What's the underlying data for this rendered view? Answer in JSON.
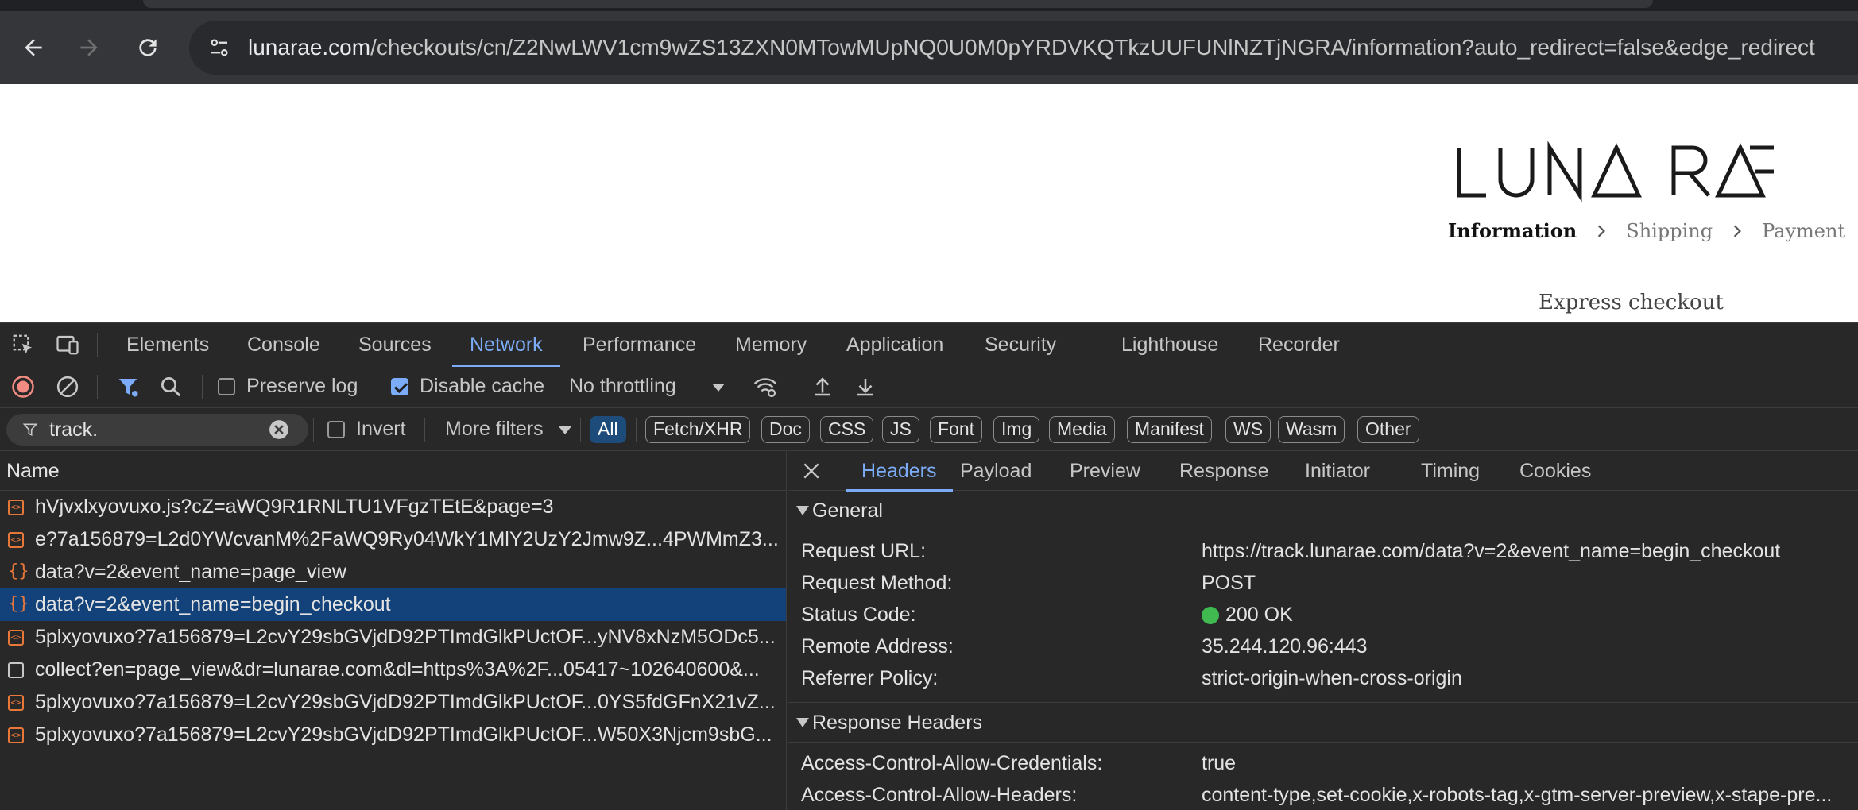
{
  "browser": {
    "url_host": "lunarae.com",
    "url_rest": "/checkouts/cn/Z2NwLWV1cm9wZS13ZXN0MTowMUpNQ0U0M0pYRDVKQTkzUUFUNlNZTjNGRA/information?auto_redirect=false&edge_redirect"
  },
  "page": {
    "brand": "LUNA RAE",
    "steps": [
      "Information",
      "Shipping",
      "Payment"
    ],
    "express_checkout": "Express checkout"
  },
  "devtools": {
    "panel_tabs": [
      "Elements",
      "Console",
      "Sources",
      "Network",
      "Performance",
      "Memory",
      "Application",
      "Security",
      "Lighthouse",
      "Recorder"
    ],
    "active_tab": "Network",
    "toolbar": {
      "preserve_log": "Preserve log",
      "preserve_log_checked": false,
      "disable_cache": "Disable cache",
      "disable_cache_checked": true,
      "throttling": "No throttling"
    },
    "filter": {
      "value": "track.",
      "invert": "Invert",
      "more_filters": "More filters",
      "types": [
        "All",
        "Fetch/XHR",
        "Doc",
        "CSS",
        "JS",
        "Font",
        "Img",
        "Media",
        "Manifest",
        "WS",
        "Wasm",
        "Other"
      ],
      "active_type": "All"
    },
    "requests": {
      "header": "Name",
      "rows": [
        {
          "name": "hVjvxlxyovuxo.js?cZ=aWQ9R1RNLTU1VFgzTEtE&page=3",
          "type": "script"
        },
        {
          "name": "e?7a156879=L2d0YWcvanM%2FaWQ9Ry04WkY1MlY2UzY2Jmw9Z...4PWMmZ3...",
          "type": "script"
        },
        {
          "name": "data?v=2&event_name=page_view",
          "type": "fetch"
        },
        {
          "name": "data?v=2&event_name=begin_checkout",
          "type": "fetch",
          "selected": true
        },
        {
          "name": "5plxyovuxo?7a156879=L2cvY29sbGVjdD92PTImdGlkPUctOF...yNV8xNzM5ODc5...",
          "type": "script"
        },
        {
          "name": "collect?en=page_view&dr=lunarae.com&dl=https%3A%2F...05417~102640600&...",
          "type": "doc"
        },
        {
          "name": "5plxyovuxo?7a156879=L2cvY29sbGVjdD92PTImdGlkPUctOF...0YS5fdGFnX21vZ...",
          "type": "script"
        },
        {
          "name": "5plxyovuxo?7a156879=L2cvY29sbGVjdD92PTImdGlkPUctOF...W50X3Njcm9sbG...",
          "type": "script"
        }
      ]
    },
    "details": {
      "tabs": [
        "Headers",
        "Payload",
        "Preview",
        "Response",
        "Initiator",
        "Timing",
        "Cookies"
      ],
      "active_tab": "Headers",
      "general_title": "General",
      "general": [
        {
          "key": "Request URL:",
          "value": "https://track.lunarae.com/data?v=2&event_name=begin_checkout"
        },
        {
          "key": "Request Method:",
          "value": "POST"
        },
        {
          "key": "Status Code:",
          "value": "200 OK"
        },
        {
          "key": "Remote Address:",
          "value": "35.244.120.96:443"
        },
        {
          "key": "Referrer Policy:",
          "value": "strict-origin-when-cross-origin"
        }
      ],
      "response_title": "Response Headers",
      "response": [
        {
          "key": "Access-Control-Allow-Credentials:",
          "value": "true"
        },
        {
          "key": "Access-Control-Allow-Headers:",
          "value": "content-type,set-cookie,x-robots-tag,x-gtm-server-preview,x-stape-pre..."
        }
      ]
    }
  }
}
